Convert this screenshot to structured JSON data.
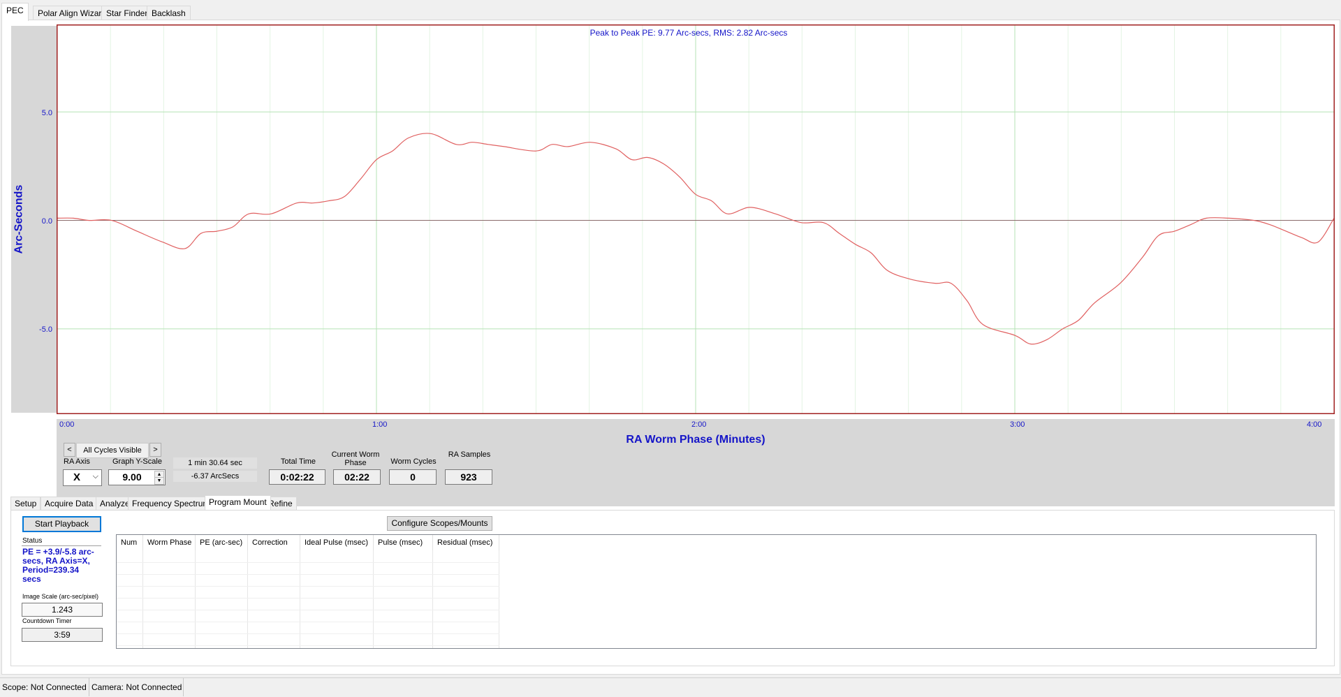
{
  "top_tabs": [
    "PEC",
    "Polar Align Wizard",
    "Star Finder",
    "Backlash"
  ],
  "chart": {
    "annotation": "Peak to Peak PE: 9.77 Arc-secs,  RMS: 2.82 Arc-secs",
    "y_label": "Arc-Seconds",
    "x_label": "RA Worm Phase (Minutes)",
    "y_ticks": [
      "5.0",
      "0.0",
      "-5.0"
    ],
    "x_ticks": [
      "0:00",
      "1:00",
      "2:00",
      "3:00",
      "4:00"
    ]
  },
  "chart_data": {
    "type": "line",
    "title": "Peak to Peak PE: 9.77 Arc-secs,  RMS: 2.82 Arc-secs",
    "xlabel": "RA Worm Phase (Minutes)",
    "ylabel": "Arc-Seconds",
    "xlim": [
      0,
      4
    ],
    "ylim": [
      -8.9,
      9.0
    ],
    "grid": true,
    "x": [
      0.0,
      0.05,
      0.1,
      0.17,
      0.25,
      0.33,
      0.4,
      0.45,
      0.5,
      0.55,
      0.6,
      0.67,
      0.75,
      0.8,
      0.85,
      0.9,
      0.95,
      1.0,
      1.05,
      1.1,
      1.17,
      1.25,
      1.3,
      1.35,
      1.4,
      1.5,
      1.55,
      1.6,
      1.67,
      1.75,
      1.8,
      1.85,
      1.9,
      1.95,
      2.0,
      2.05,
      2.1,
      2.17,
      2.25,
      2.33,
      2.4,
      2.45,
      2.5,
      2.55,
      2.6,
      2.67,
      2.75,
      2.8,
      2.85,
      2.9,
      3.0,
      3.05,
      3.1,
      3.15,
      3.2,
      3.25,
      3.33,
      3.4,
      3.45,
      3.5,
      3.55,
      3.6,
      3.67,
      3.75,
      3.8,
      3.85,
      3.9,
      3.95,
      4.0
    ],
    "series": [
      {
        "values": [
          0.1,
          0.1,
          0.0,
          0.0,
          -0.5,
          -1.0,
          -1.3,
          -0.6,
          -0.5,
          -0.3,
          0.3,
          0.3,
          0.8,
          0.8,
          0.9,
          1.1,
          1.9,
          2.8,
          3.2,
          3.8,
          4.0,
          3.5,
          3.6,
          3.5,
          3.4,
          3.2,
          3.5,
          3.4,
          3.6,
          3.3,
          2.8,
          2.9,
          2.6,
          2.0,
          1.2,
          0.9,
          0.3,
          0.6,
          0.3,
          -0.1,
          -0.1,
          -0.6,
          -1.1,
          -1.5,
          -2.3,
          -2.7,
          -2.9,
          -2.9,
          -3.7,
          -4.8,
          -5.3,
          -5.7,
          -5.5,
          -5.0,
          -4.6,
          -3.8,
          -2.9,
          -1.7,
          -0.7,
          -0.5,
          -0.2,
          0.1,
          0.1,
          0.0,
          -0.2,
          -0.5,
          -0.8,
          -1.0,
          0.1
        ]
      }
    ]
  },
  "controls": {
    "cycle_prev": "<",
    "cycle_label": "All Cycles Visible",
    "cycle_next": ">",
    "ra_axis_label": "RA Axis",
    "ra_axis_value": "X",
    "yscale_label": "Graph Y-Scale",
    "yscale_value": "9.00",
    "info_line1": "1 min  30.64 sec",
    "info_line2": "-6.37 ArcSecs",
    "total_time_label": "Total Time",
    "total_time_value": "0:02:22",
    "worm_phase_label": "Current Worm Phase",
    "worm_phase_value": "02:22",
    "worm_cycles_label": "Worm Cycles",
    "worm_cycles_value": "0",
    "ra_samples_label": "RA Samples",
    "ra_samples_value": "923"
  },
  "sub_tabs": [
    "Setup",
    "Acquire Data",
    "Analyze",
    "Frequency Spectrum",
    "Program Mount",
    "Refine"
  ],
  "program_mount": {
    "start_playback": "Start Playback",
    "configure": "Configure Scopes/Mounts",
    "status_label": "Status",
    "status_text": "PE = +3.9/-5.8 arc-secs,  RA Axis=X, Period=239.34 secs",
    "image_scale_label": "Image Scale (arc-sec/pixel)",
    "image_scale_value": "1.243",
    "countdown_label": "Countdown Timer",
    "countdown_value": "3:59",
    "columns": [
      "Num",
      "Worm Phase",
      "PE (arc-sec)",
      "Correction",
      "Ideal Pulse (msec)",
      "Pulse (msec)",
      "Residual (msec)"
    ]
  },
  "status_bar": {
    "scope": "Scope: Not Connected",
    "camera": "Camera: Not Connected"
  },
  "colors": {
    "accent": "#0078d7",
    "axis_blue": "#1414c8",
    "plot_red": "#e06060",
    "frame_red": "#a02020"
  }
}
